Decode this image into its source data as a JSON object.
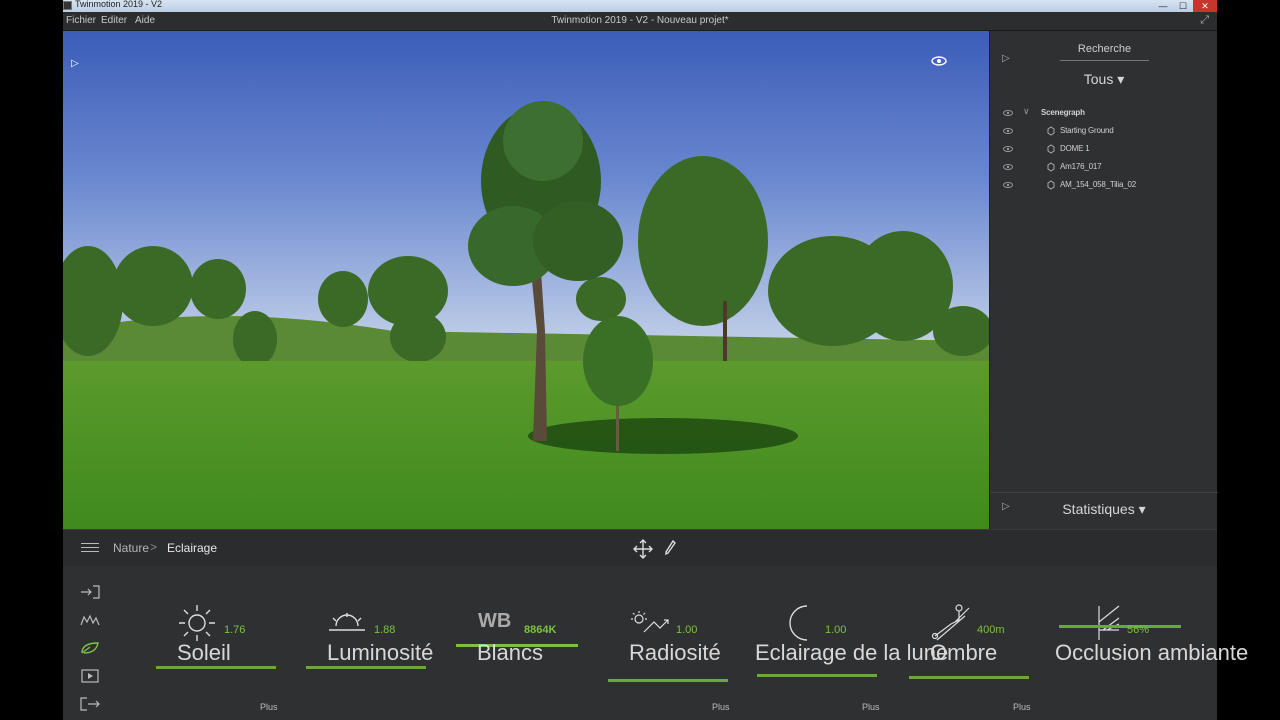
{
  "titlebar": {
    "title": "Twinmotion 2019 - V2",
    "minimize": "—",
    "maximize": "☐",
    "close": "✕"
  },
  "menu": {
    "items": [
      "Fichier",
      "Editer",
      "Aide"
    ],
    "window_title": "Twinmotion 2019 - V2 - Nouveau projet*",
    "expand_icon": "⤢"
  },
  "viewport": {
    "play_icon": "▷"
  },
  "right_panel": {
    "play_icon": "▷",
    "search_label": "Recherche",
    "filter": "Tous ▾",
    "tree": [
      {
        "label": "Scenegraph",
        "type": "root",
        "chevron": "∨"
      },
      {
        "label": "Starting Ground",
        "type": "child"
      },
      {
        "label": "DOME 1",
        "type": "child"
      },
      {
        "label": "Am176_017",
        "type": "child"
      },
      {
        "label": "AM_154_058_Tilia_02",
        "type": "child"
      }
    ],
    "stats_label": "Statistiques ▾"
  },
  "breadcrumb": {
    "items": [
      "Nature",
      "Eclairage"
    ],
    "separator": ">"
  },
  "bottom": {
    "settings": [
      {
        "name": "Soleil",
        "value": "1.76"
      },
      {
        "name": "Luminosité",
        "value": "1.88"
      },
      {
        "name": "Blancs",
        "value": "8864K",
        "prefix": "WB"
      },
      {
        "name": "Radiosité",
        "value": "1.00"
      },
      {
        "name": "Eclairage de la lune",
        "value": "1.00"
      },
      {
        "name": "Ombre",
        "value": "400m"
      },
      {
        "name": "Occlusion ambiante",
        "value": "56%"
      }
    ],
    "plus_labels": [
      "Plus",
      "Plus",
      "Plus",
      "Plus"
    ]
  },
  "colors": {
    "accent": "#7cc242",
    "panel": "#2f3032",
    "bar": "#6aa83c"
  }
}
